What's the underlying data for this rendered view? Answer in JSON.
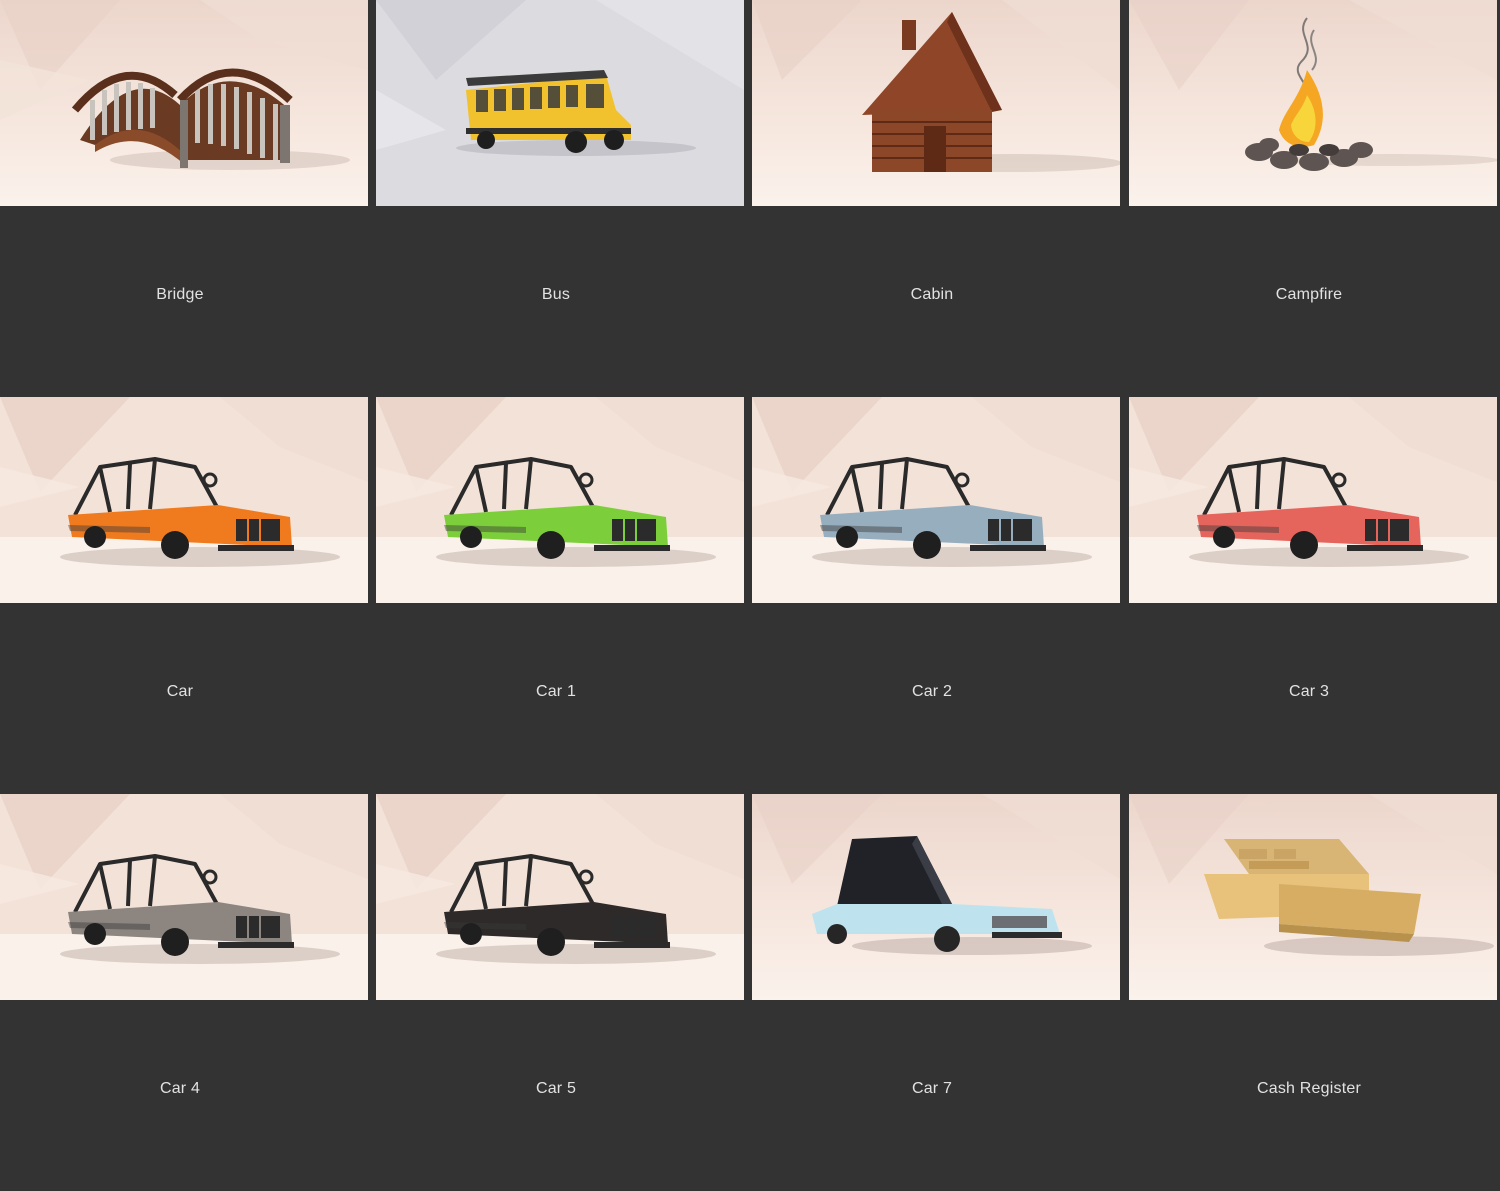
{
  "gallery": {
    "items": [
      {
        "label": "Bridge",
        "preview": "bridge-preview"
      },
      {
        "label": "Bus",
        "preview": "bus-preview"
      },
      {
        "label": "Cabin",
        "preview": "cabin-preview"
      },
      {
        "label": "Campfire",
        "preview": "campfire-preview"
      },
      {
        "label": "Car",
        "preview": "car-preview",
        "body_color": "#f07a1e"
      },
      {
        "label": "Car 1",
        "preview": "car-1-preview",
        "body_color": "#7ccf3a"
      },
      {
        "label": "Car 2",
        "preview": "car-2-preview",
        "body_color": "#97aebf"
      },
      {
        "label": "Car 3",
        "preview": "car-3-preview",
        "body_color": "#e5645c"
      },
      {
        "label": "Car 4",
        "preview": "car-4-preview",
        "body_color": "#8c8580"
      },
      {
        "label": "Car 5",
        "preview": "car-5-preview",
        "body_color": "#2e2a29"
      },
      {
        "label": "Car 7",
        "preview": "car-7-preview",
        "body_color": "#bfe3ee"
      },
      {
        "label": "Cash Register",
        "preview": "cash-register-preview",
        "body_color": "#e8c27a"
      }
    ]
  },
  "colors": {
    "background": "#333333",
    "label_text": "#e2e2e2",
    "scene_backdrop": "#f4e2d8",
    "bus_backdrop": "#dcdbe0"
  }
}
